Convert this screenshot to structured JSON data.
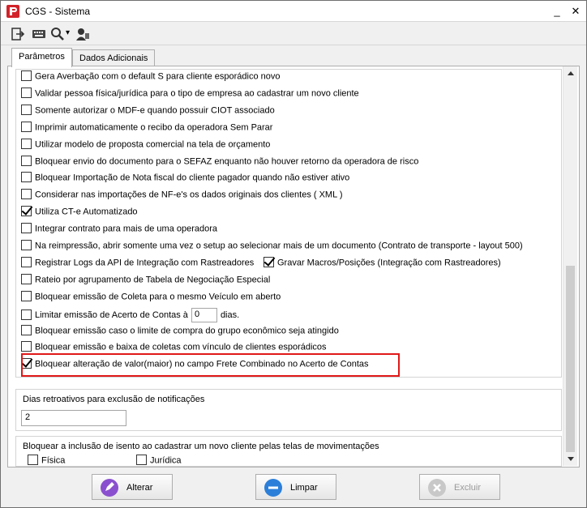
{
  "window": {
    "title": "CGS - Sistema",
    "minimize_glyph": "_",
    "maximize_glyph": "□",
    "close_glyph": "✕"
  },
  "toolbar": {
    "icons": [
      "exit-icon",
      "keyboard-icon",
      "search-icon",
      "user-icon"
    ],
    "dropdown_glyph": "▾"
  },
  "tabs": [
    {
      "label": "Parâmetros",
      "active": true
    },
    {
      "label": "Dados Adicionais",
      "active": false
    }
  ],
  "options": [
    {
      "label": "Gera Averbação com o default S para cliente esporádico novo",
      "checked": false
    },
    {
      "label": "Validar pessoa física/jurídica para o tipo de empresa ao cadastrar um novo cliente",
      "checked": false
    },
    {
      "label": "Somente autorizar o MDF-e quando possuir CIOT associado",
      "checked": false
    },
    {
      "label": "Imprimir automaticamente o recibo da operadora Sem Parar",
      "checked": false
    },
    {
      "label": "Utilizar modelo de proposta comercial na tela de orçamento",
      "checked": false
    },
    {
      "label": "Bloquear envio do documento para o SEFAZ  enquanto não houver retorno da operadora de risco",
      "checked": false
    },
    {
      "label": "Bloquear Importação de Nota fiscal do cliente pagador quando não estiver ativo",
      "checked": false
    },
    {
      "label": "Considerar nas importações de NF-e's os dados originais dos clientes ( XML )",
      "checked": false
    },
    {
      "label": "Utiliza CT-e Automatizado",
      "checked": true
    },
    {
      "label": "Integrar contrato para mais de uma operadora",
      "checked": false
    },
    {
      "label": "Na reimpressão, abrir somente uma vez o setup ao selecionar mais de um documento (Contrato de transporte - layout 500)",
      "checked": false
    }
  ],
  "logs_row": {
    "left": {
      "label": "Registrar Logs da API de Integração com Rastreadores",
      "checked": false
    },
    "right": {
      "label": "Gravar Macros/Posições (Integração com Rastreadores)",
      "checked": true
    }
  },
  "options2": [
    {
      "label": "Rateio por agrupamento de Tabela de Negociação Especial",
      "checked": false
    },
    {
      "label": "Bloquear emissão de Coleta para o mesmo Veículo em aberto",
      "checked": false
    }
  ],
  "limit_row": {
    "label_before": "Limitar emissão de Acerto de Contas à",
    "value": "0",
    "label_after": "dias.",
    "checked": false
  },
  "options3": [
    {
      "label": "Bloquear emissão caso o limite de compra do grupo econômico seja atingido",
      "checked": false
    },
    {
      "label": "Bloquear emissão e baixa de coletas com vínculo de clientes esporádicos",
      "checked": false
    }
  ],
  "highlighted_option": {
    "label": "Bloquear alteração de valor(maior) no campo Frete Combinado no Acerto de Contas",
    "checked": true,
    "highlight_color": "#e01818"
  },
  "retro_group": {
    "title": "Dias retroativos para exclusão de notificações",
    "value": "2"
  },
  "isento_group": {
    "title": "Bloquear a inclusão de isento ao cadastrar um novo cliente pelas telas de movimentações",
    "fisica": {
      "label": "Física",
      "checked": false
    },
    "juridica": {
      "label": "Jurídica",
      "checked": false
    }
  },
  "buttons": {
    "alterar": "Alterar",
    "limpar": "Limpar",
    "excluir": "Excluir"
  },
  "colors": {
    "alterar_icon": "#8a4fcf",
    "limpar_icon": "#2b7fd9",
    "excluir_icon": "#c8c8c8"
  }
}
